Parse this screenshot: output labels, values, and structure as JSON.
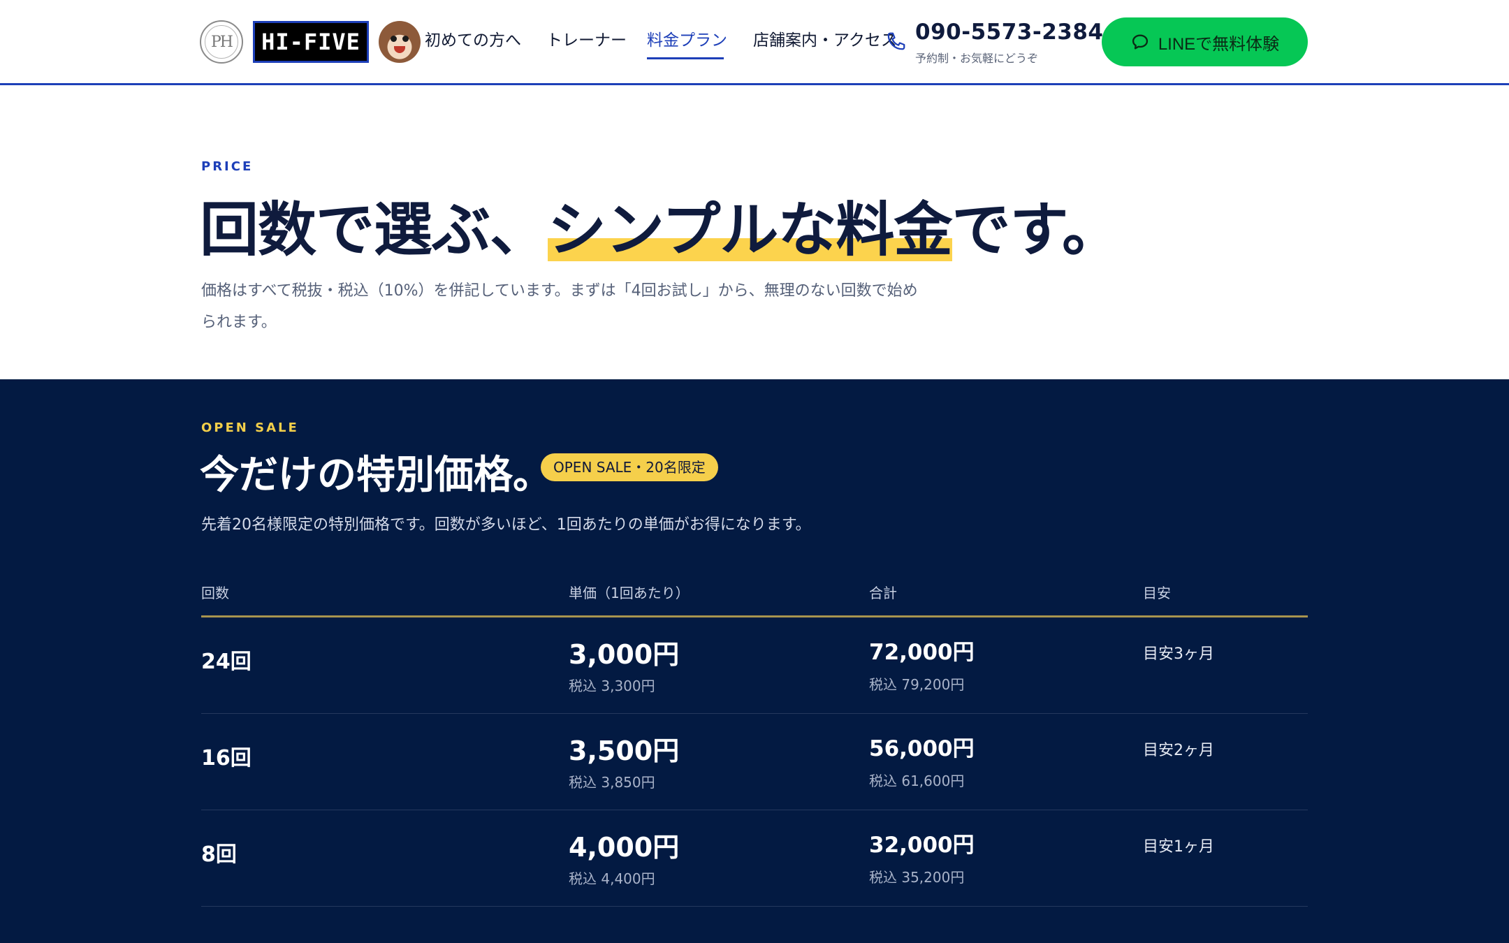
{
  "header": {
    "logo_badge_text": "PH",
    "logo_text": "HI-FIVE",
    "nav": [
      {
        "label": "初めての方へ"
      },
      {
        "label": "トレーナー"
      },
      {
        "label": "料金プラン"
      },
      {
        "label": "店舗案内・アクセス"
      }
    ],
    "phone_number": "090-5573-2384",
    "phone_note": "予約制・お気軽にどうぞ",
    "line_button_label": "LINEで無料体験"
  },
  "price": {
    "eyebrow": "PRICE",
    "headline_pre": "回数で選ぶ、",
    "headline_highlight": "シンプルな料金",
    "headline_post": "です。",
    "lead": "価格はすべて税抜・税込（10%）を併記しています。まずは「4回お試し」から、無理のない回数で始められます。"
  },
  "sale": {
    "eyebrow": "OPEN SALE",
    "title": "今だけの特別価格。",
    "badge": "OPEN SALE・20名限定",
    "lead": "先着20名様限定の特別価格です。回数が多いほど、1回あたりの単価がお得になります。",
    "columns": [
      "回数",
      "単価（1回あたり）",
      "合計",
      "目安"
    ],
    "rows": [
      {
        "count": "24回",
        "unit": "3,000円",
        "unit_tax": "税込 3,300円",
        "total": "72,000円",
        "total_tax": "税込 79,200円",
        "guide": "目安3ヶ月"
      },
      {
        "count": "16回",
        "unit": "3,500円",
        "unit_tax": "税込 3,850円",
        "total": "56,000円",
        "total_tax": "税込 61,600円",
        "guide": "目安2ヶ月"
      },
      {
        "count": "8回",
        "unit": "4,000円",
        "unit_tax": "税込 4,400円",
        "total": "32,000円",
        "total_tax": "税込 35,200円",
        "guide": "目安1ヶ月"
      }
    ]
  },
  "colors": {
    "brand_blue": "#1d3fb8",
    "navy": "#031a42",
    "highlight_yellow": "#fcd34d",
    "line_green": "#06c755"
  },
  "icons": {
    "phone": "phone-icon",
    "line": "chat-bubble-icon"
  }
}
